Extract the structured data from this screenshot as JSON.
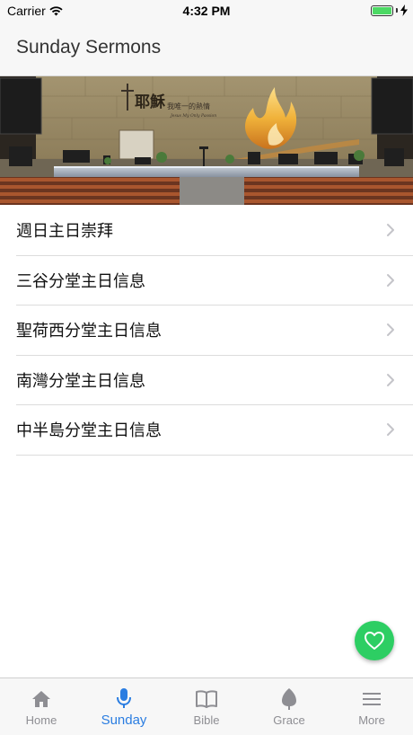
{
  "status_bar": {
    "carrier": "Carrier",
    "time": "4:32 PM",
    "battery_level": 1.0
  },
  "header": {
    "title": "Sunday Sermons"
  },
  "banner": {
    "image_text_main": "耶穌",
    "image_text_side": "我唯一的熱情",
    "image_text_en": "Jesus My Only Passion"
  },
  "list": {
    "items": [
      {
        "label": "週日主日崇拜"
      },
      {
        "label": "三谷分堂主日信息"
      },
      {
        "label": "聖荷西分堂主日信息"
      },
      {
        "label": "南灣分堂主日信息"
      },
      {
        "label": "中半島分堂主日信息"
      }
    ]
  },
  "fab": {
    "icon": "heart-outline-icon",
    "color": "#2dce63"
  },
  "tab_bar": {
    "active_color": "#2a7de1",
    "tabs": [
      {
        "label": "Home",
        "icon": "home-icon"
      },
      {
        "label": "Sunday",
        "icon": "microphone-icon"
      },
      {
        "label": "Bible",
        "icon": "book-icon"
      },
      {
        "label": "Grace",
        "icon": "leaf-icon"
      },
      {
        "label": "More",
        "icon": "menu-icon"
      }
    ]
  }
}
